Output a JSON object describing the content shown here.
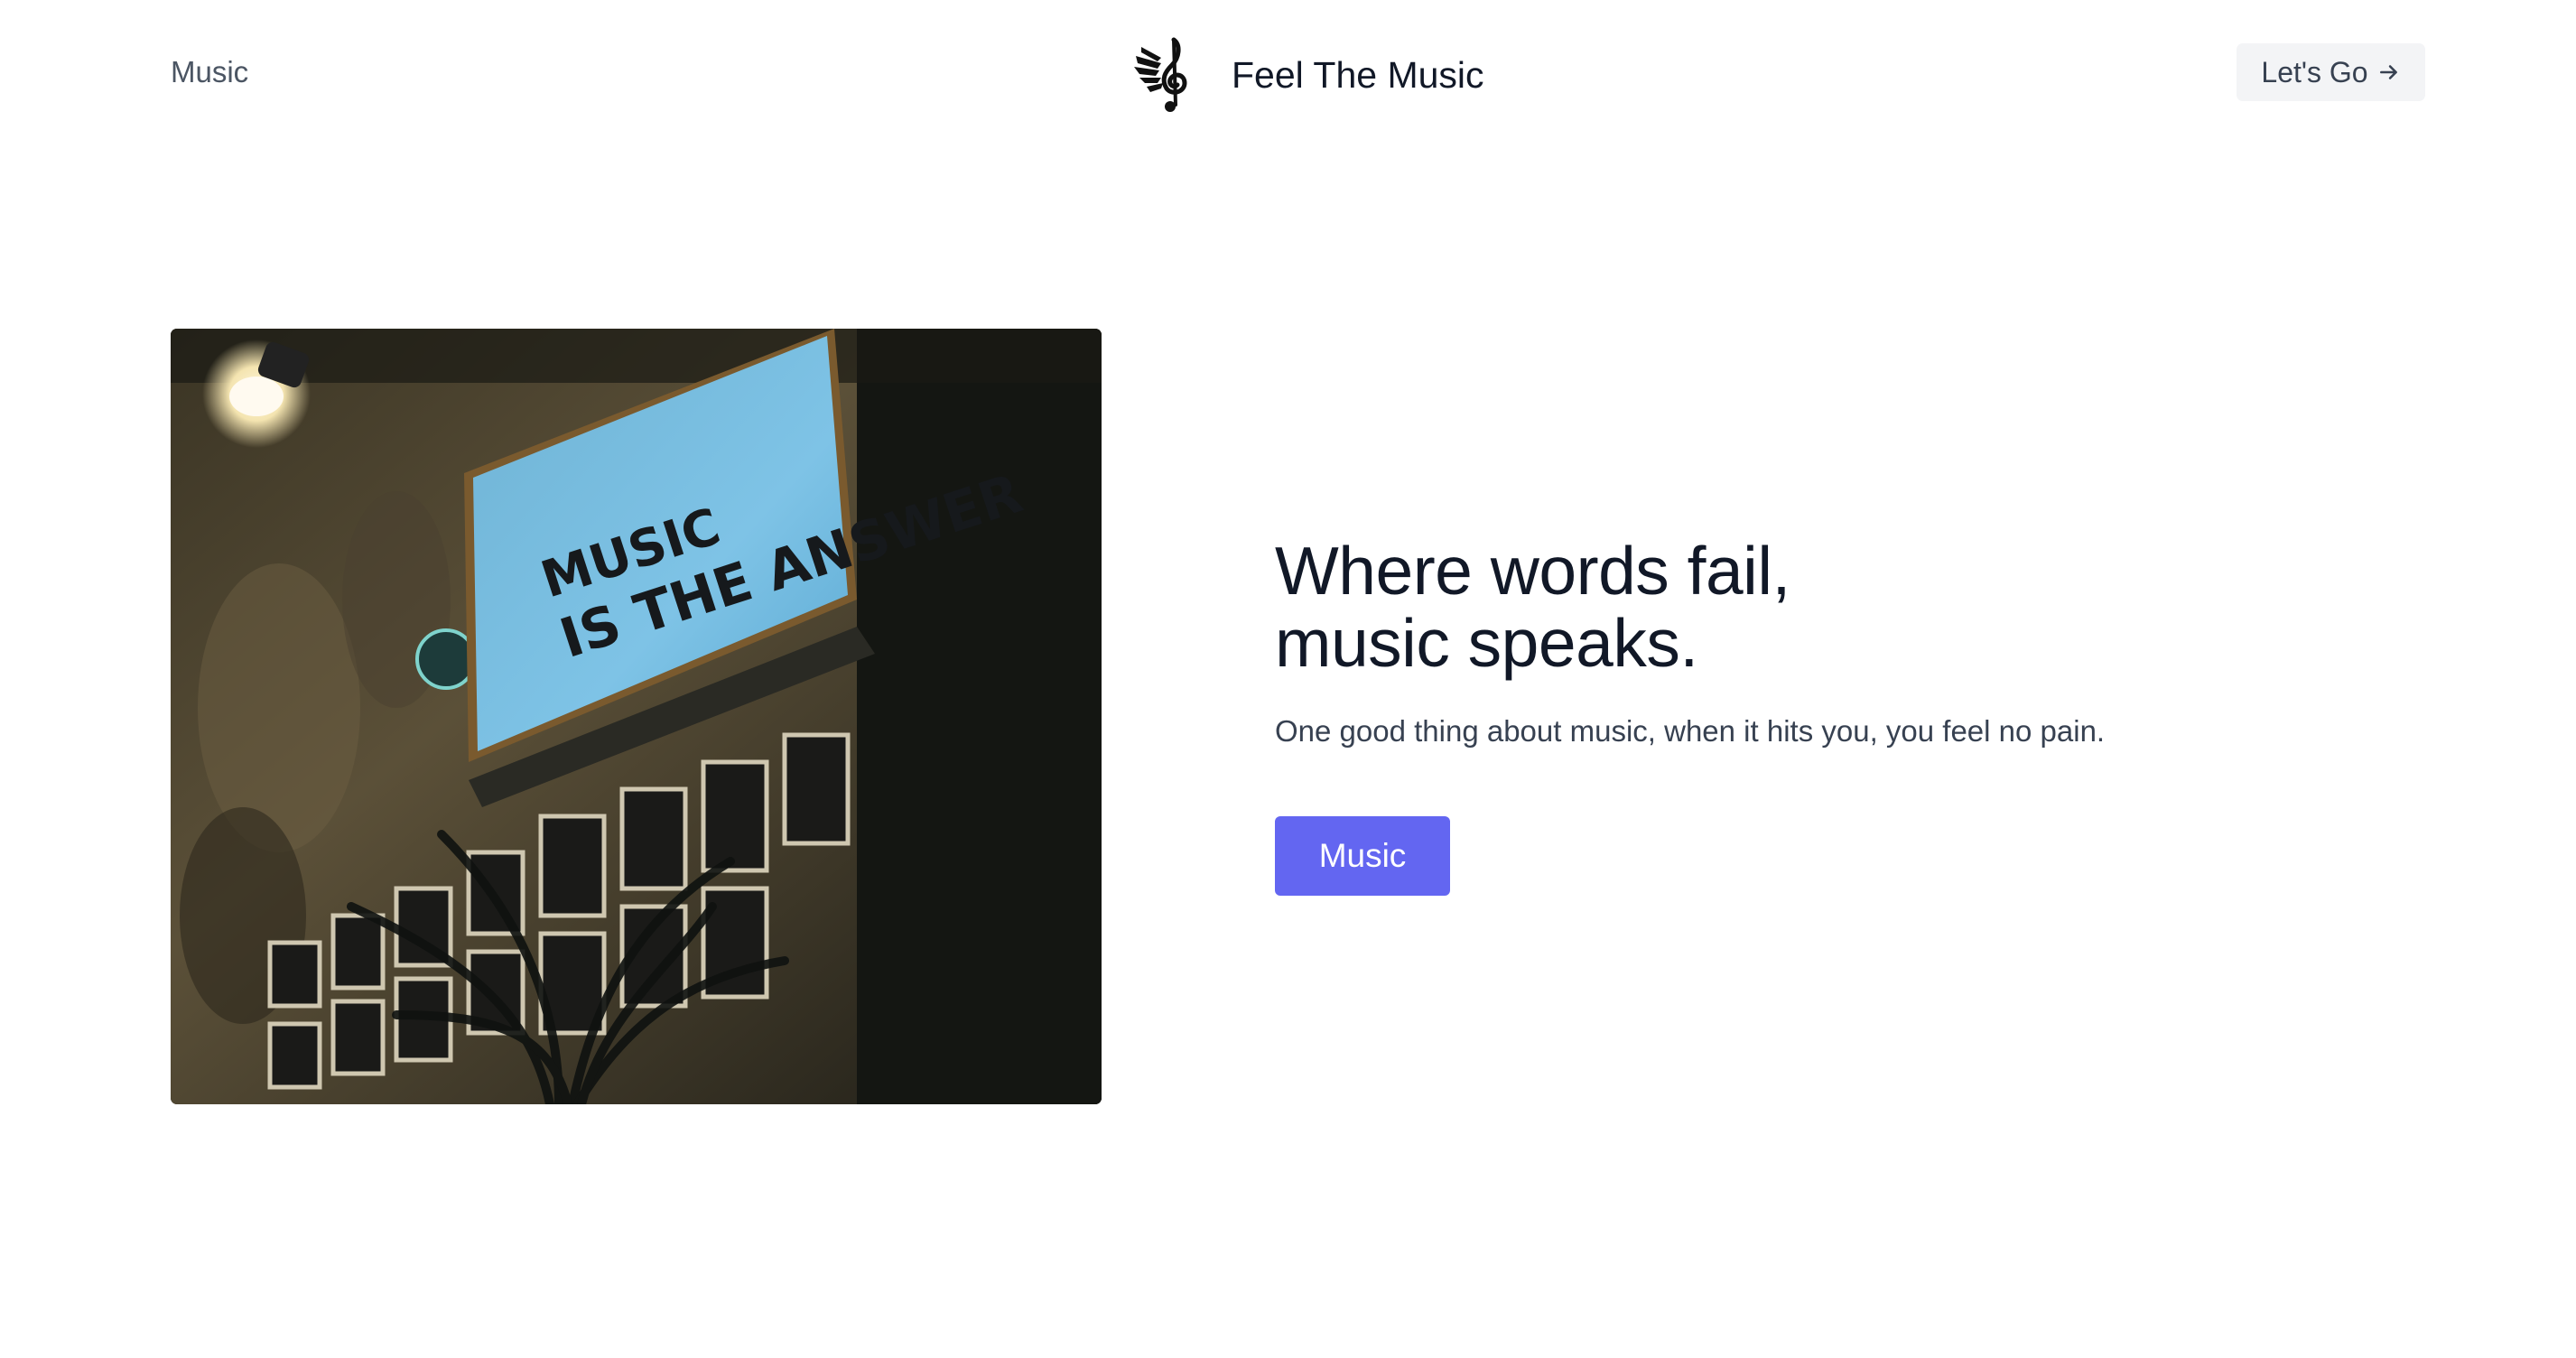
{
  "header": {
    "nav_link": "Music",
    "brand_name": "Feel The Music",
    "cta_label": "Let's Go",
    "cta_icon": "arrow-right-icon",
    "logo_icon": "winged-treble-clef-icon"
  },
  "hero": {
    "title_line_1": "Where words fail,",
    "title_line_2": "music speaks.",
    "subtitle": "One good thing about music, when it hits you, you feel no pain.",
    "button_label": "Music",
    "image": {
      "sign_line_1": "MUSIC",
      "sign_line_2": "IS THE ANSWER"
    }
  },
  "colors": {
    "primary": "#6366f1",
    "heading": "#111827",
    "body_text": "#374151",
    "muted_text": "#4b5563",
    "cta_background": "#f3f4f6"
  }
}
